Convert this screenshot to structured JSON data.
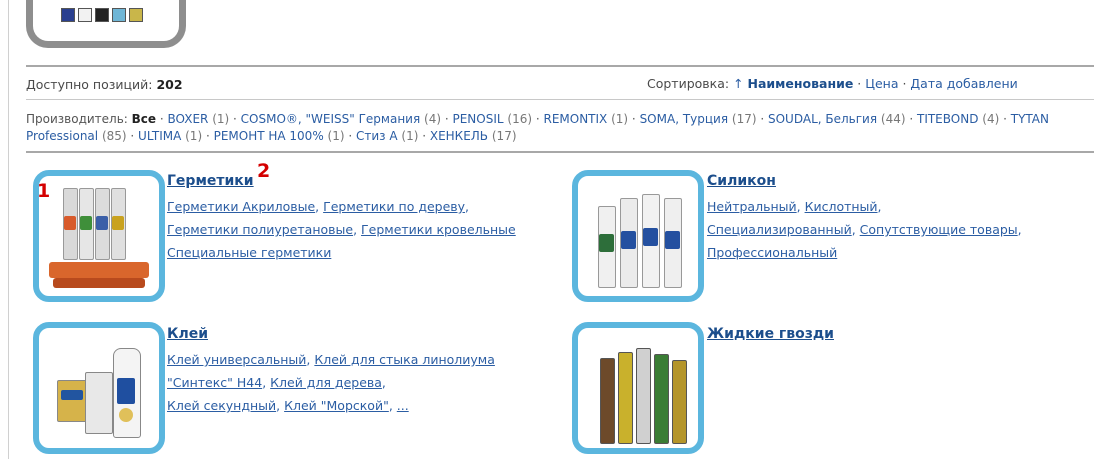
{
  "summary": {
    "count_label": "Доступно позиций: ",
    "count_value": "202",
    "sort_label": "Сортировка: ",
    "sort_arrow": "↑",
    "sort_current": "Наименование",
    "sort_options": [
      "Цена",
      "Дата добавлени"
    ],
    "sort_separator": " · "
  },
  "manufacturers": {
    "label": "Производитель: ",
    "current": "Все",
    "items": [
      {
        "name": "BOXER",
        "count": "(1)"
      },
      {
        "name": "COSMO®, \"WEISS\" Германия",
        "count": "(4)"
      },
      {
        "name": "PENOSIL",
        "count": "(16)"
      },
      {
        "name": "REMONTIX",
        "count": "(1)"
      },
      {
        "name": "SOMA, Турция",
        "count": "(17)"
      },
      {
        "name": "SOUDAL, Бельгия",
        "count": "(44)"
      },
      {
        "name": "TITEBOND",
        "count": "(4)"
      },
      {
        "name": "TYTAN Professional",
        "count": "(85)"
      },
      {
        "name": "ULTIMA",
        "count": "(1)"
      },
      {
        "name": "РЕМОНТ НА 100%",
        "count": "(1)"
      },
      {
        "name": "Стиз А",
        "count": "(1)"
      },
      {
        "name": "ХЕНКЕЛЬ",
        "count": "(17)"
      }
    ]
  },
  "categories": [
    {
      "title": "Герметики",
      "links": [
        "Герметики Акриловые",
        "Герметики по дереву",
        "Герметики полиуретановые",
        "Герметики кровельные",
        "Специальные герметики"
      ]
    },
    {
      "title": "Силикон",
      "links": [
        "Нейтральный",
        "Кислотный",
        "Специализированный",
        "Сопутствующие товары",
        "Профессиональный"
      ]
    },
    {
      "title": "Клей",
      "links": [
        "Клей универсальный",
        "Клей для стыка линолиума \"Синтекс\" Н44",
        "Клей для дерева",
        "Клей секундный",
        "Клей \"Морской\"",
        "..."
      ]
    },
    {
      "title": "Жидкие гвозди",
      "links": []
    }
  ],
  "markers": [
    "1",
    "2"
  ],
  "colors": {
    "frame_blue": "#5bb6de",
    "link_blue": "#2b5da3",
    "marker_red": "#d40000"
  }
}
